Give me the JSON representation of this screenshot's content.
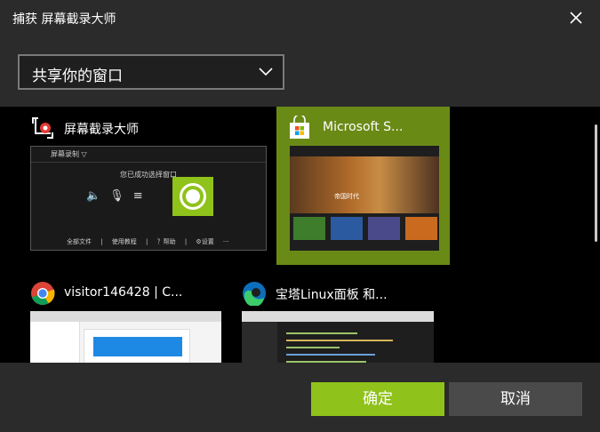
{
  "window": {
    "title": "捕获 屏幕截录大师",
    "close_icon": "close-icon"
  },
  "source_select": {
    "value": "共享你的窗口"
  },
  "windows": [
    {
      "title": "屏幕截录大师",
      "icon": "capture-app-icon",
      "selected": false,
      "thumb": {
        "app_name": "屏幕录制 ▽",
        "center_text": "您已成功选择窗口",
        "footer": "全部文件  |  使用教程  |  ？帮助  |  ⚙设置  ···"
      }
    },
    {
      "title": "Microsoft S...",
      "icon": "microsoft-store-icon",
      "selected": true,
      "thumb": {
        "hero_label": "帝国时代"
      }
    },
    {
      "title": "visitor146428 | C...",
      "icon": "chrome-icon",
      "selected": false
    },
    {
      "title": "宝塔Linux面板 和...",
      "icon": "edge-icon",
      "selected": false
    }
  ],
  "buttons": {
    "ok": "确定",
    "cancel": "取消"
  },
  "colors": {
    "accent": "#8fc21b",
    "selected_bg": "#6a8a16",
    "background": "#2b2b2b"
  }
}
